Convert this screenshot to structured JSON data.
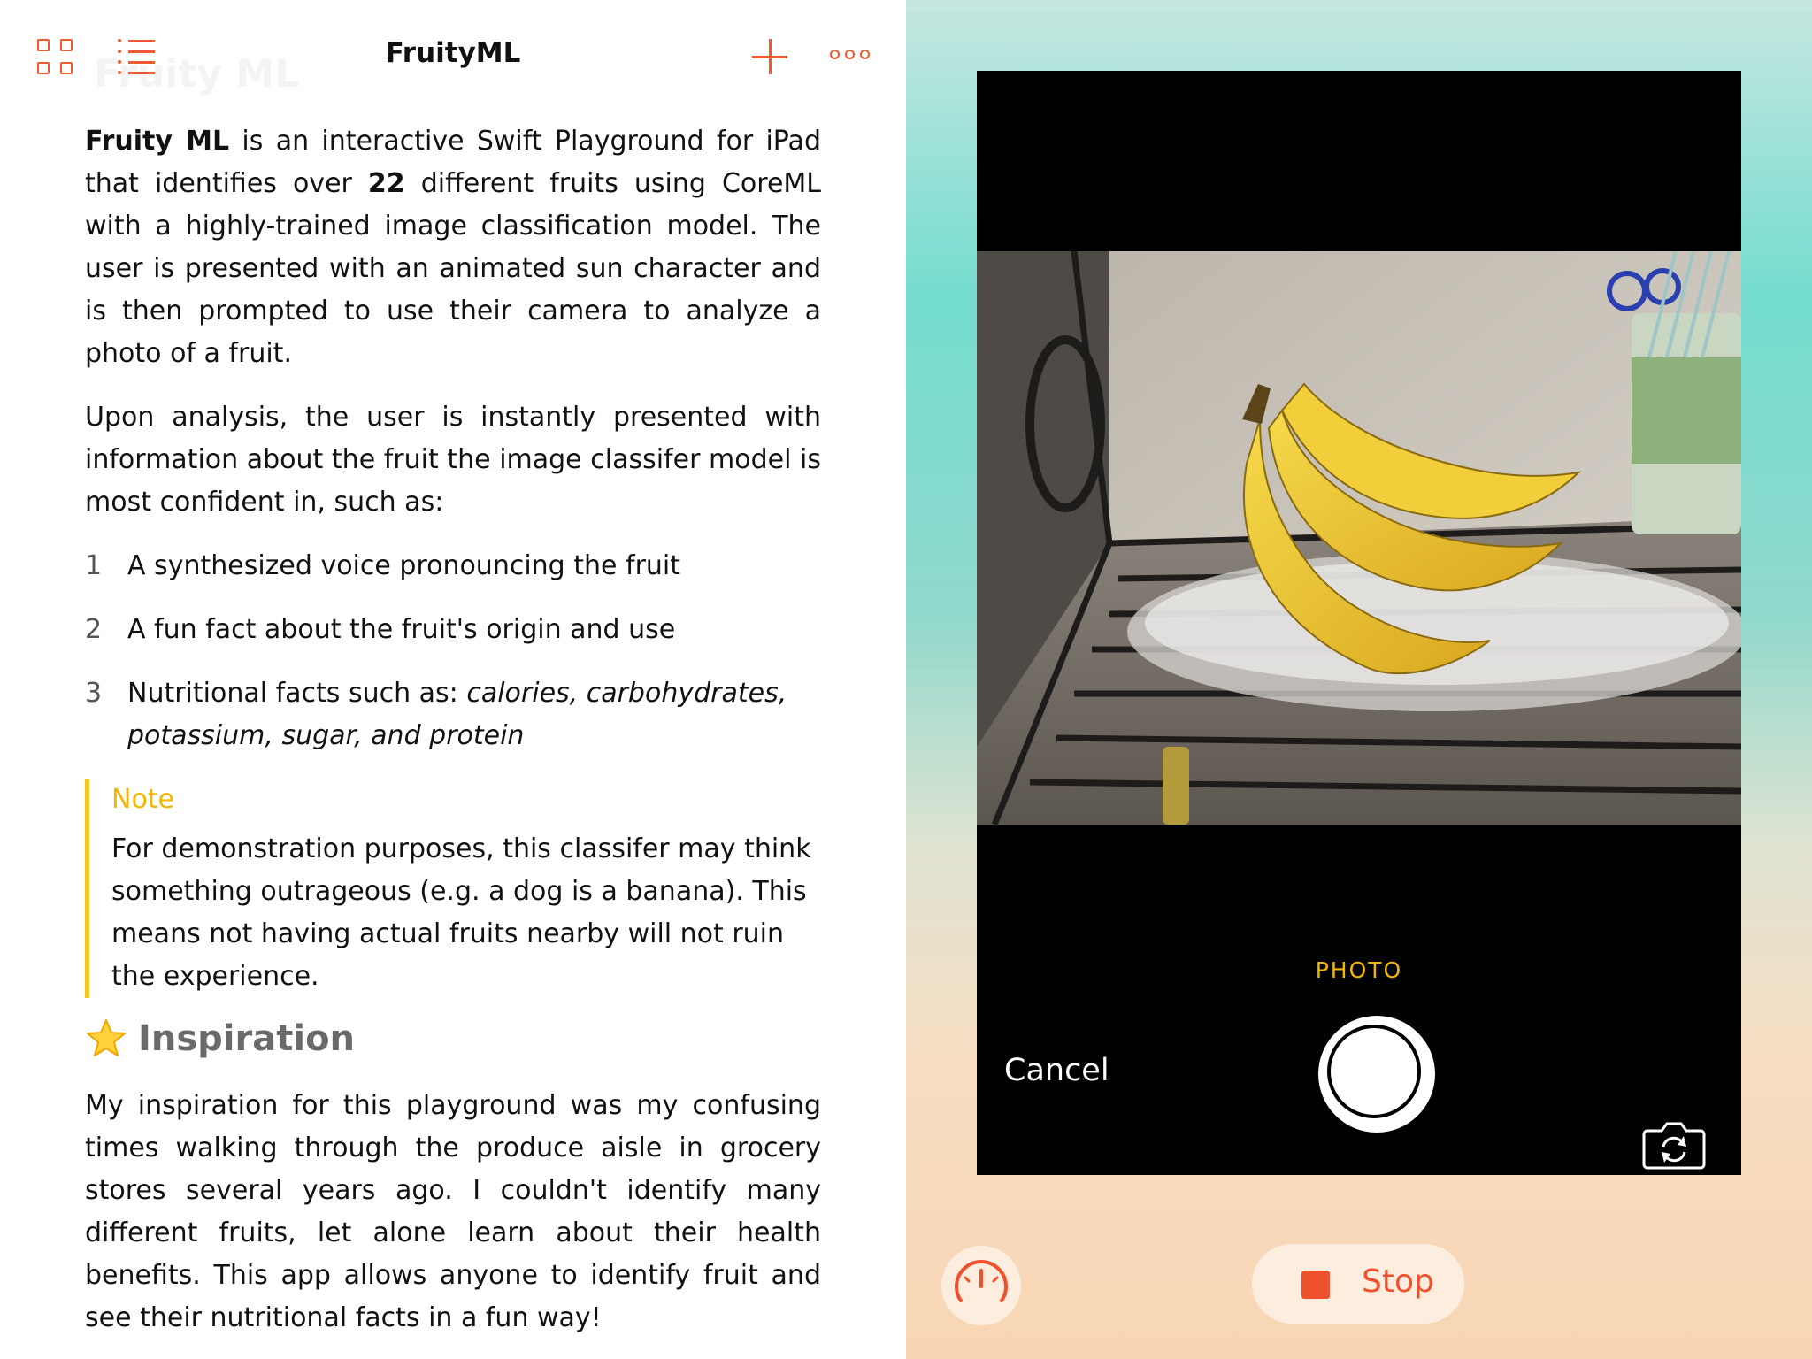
{
  "toolbar": {
    "title": "FruityML",
    "ghost_title": "Fruity ML",
    "icons": [
      "grid-icon",
      "list-icon",
      "add-icon",
      "more-icon"
    ],
    "accent_color": "#ee5b2e"
  },
  "document": {
    "intro": {
      "t1": "Fruity ML",
      "t2": " is an interactive Swift Playground for iPad that identifies over ",
      "t3": "22",
      "t4": " different fruits using CoreML with a highly-trained image classification model. The user is presented with an animated sun character and is then prompted to use their camera to analyze a photo of a fruit."
    },
    "analysis_text": "Upon analysis, the user is instantly presented with information about the fruit the image classifer model is most confident in, such as:",
    "features": [
      {
        "num": "1",
        "text": "A synthesized voice pronouncing the fruit"
      },
      {
        "num": "2",
        "text": "A fun fact about the fruit's origin and use"
      },
      {
        "num": "3",
        "text": "Nutritional facts such as: ",
        "italic": "calories, carbohydrates, potassium, sugar, and protein"
      }
    ],
    "note": {
      "title": "Note",
      "text": "For demonstration purposes, this classifer may think something outrageous (e.g. a dog is a banana). This means not having actual fruits nearby will not ruin the experience.",
      "color": "#f5c320"
    },
    "inspiration": {
      "heading": "Inspiration",
      "icon": "star-icon",
      "text": "My inspiration for this playground was my confusing times walking through the produce aisle in grocery stores several years ago. I couldn't identify many different fruits, let alone learn about their health benefits. This app allows anyone to identify fruit and see their nutritional facts in a fun way!"
    }
  },
  "camera": {
    "mode": "PHOTO",
    "cancel_label": "Cancel",
    "shutter_icon": "shutter-button",
    "flip_icon": "camera-flip-icon",
    "photo_subject": "bananas",
    "mode_color": "#f2b600"
  },
  "live_view": {
    "stop_label": "Stop",
    "speed_icon": "speedometer-icon",
    "stop_color": "#f0502c"
  }
}
